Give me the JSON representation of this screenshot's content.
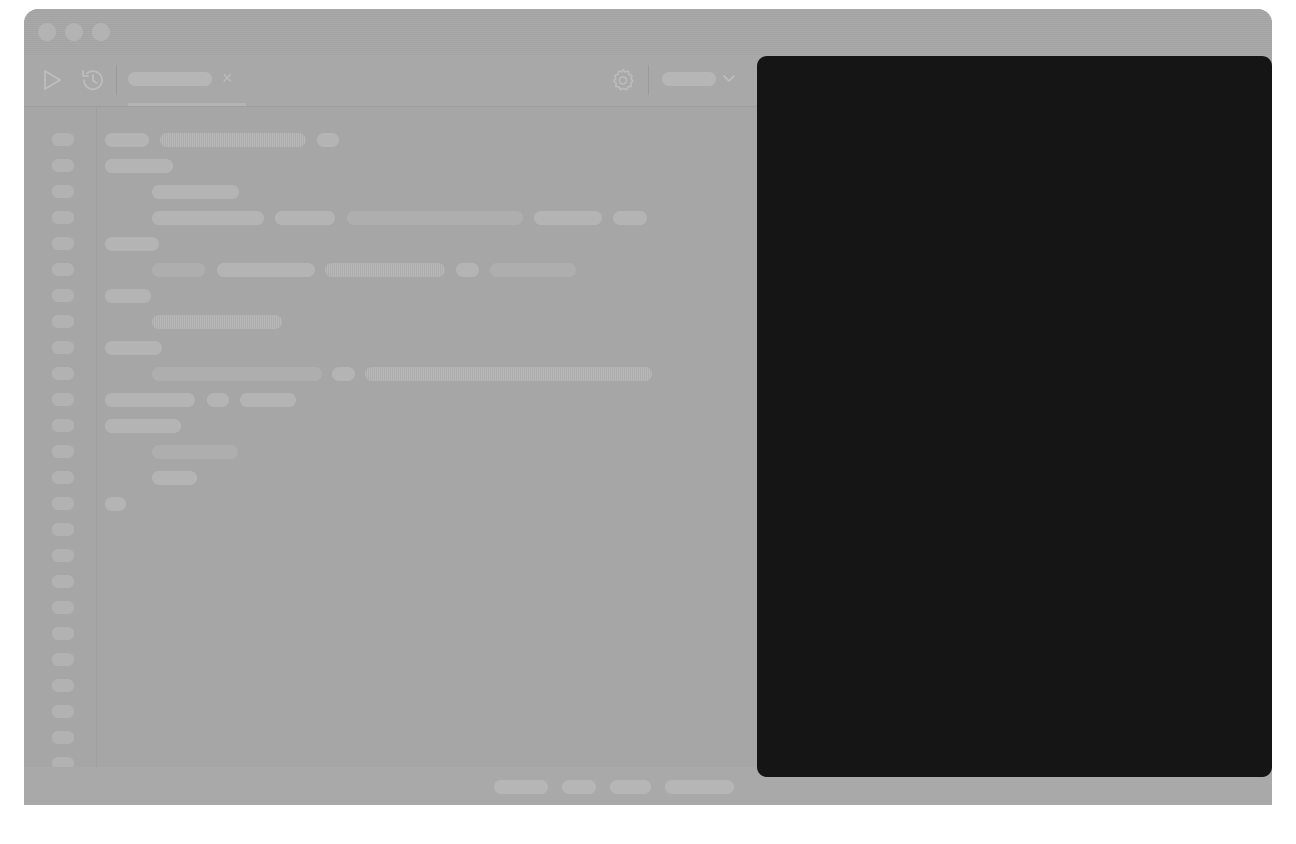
{
  "colors": {
    "window_bg": "#a6a6a6",
    "overlay_panel": "#151516",
    "placeholder_pill": "#b4b4b4"
  },
  "titlebar": {
    "traffic_lights": [
      "close",
      "minimize",
      "zoom"
    ]
  },
  "toolbar": {
    "run_icon": "play-icon",
    "history_icon": "history-icon",
    "settings_icon": "gear-icon",
    "select_chevron_icon": "chevron-down-icon",
    "tab": {
      "label": "",
      "close_glyph": "×"
    },
    "select_value": ""
  },
  "editor": {
    "line_count": 26
  },
  "status_bar": {
    "items": [
      "",
      "",
      "",
      ""
    ]
  }
}
